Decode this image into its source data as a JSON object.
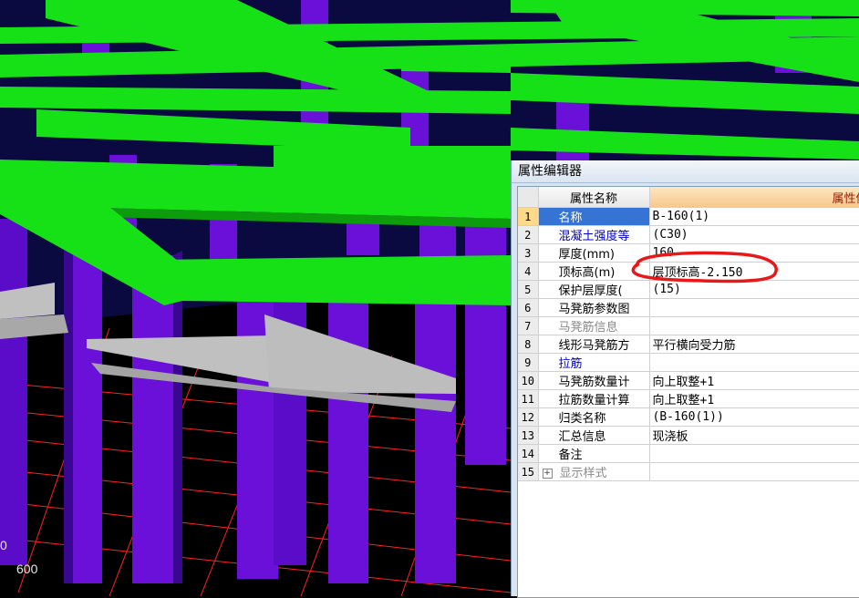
{
  "viewport": {
    "axis_labels": [
      "0",
      "600"
    ]
  },
  "panel": {
    "title": "属性编辑器",
    "header": {
      "name_col": "属性名称",
      "value_col": "属性值"
    },
    "rows": [
      {
        "no": "1",
        "name": "名称",
        "value": "B-160(1)",
        "style": "selected"
      },
      {
        "no": "2",
        "name": "混凝土强度等",
        "value": "(C30)",
        "style": "blue"
      },
      {
        "no": "3",
        "name": "厚度(mm)",
        "value": "160",
        "style": "normal"
      },
      {
        "no": "4",
        "name": "顶标高(m)",
        "value": "层顶标高-2.150",
        "style": "normal"
      },
      {
        "no": "5",
        "name": "保护层厚度(",
        "value": "(15)",
        "style": "normal"
      },
      {
        "no": "6",
        "name": "马凳筋参数图",
        "value": "",
        "style": "normal"
      },
      {
        "no": "7",
        "name": "马凳筋信息",
        "value": "",
        "style": "gray"
      },
      {
        "no": "8",
        "name": "线形马凳筋方",
        "value": "平行横向受力筋",
        "style": "normal"
      },
      {
        "no": "9",
        "name": "拉筋",
        "value": "",
        "style": "blue"
      },
      {
        "no": "10",
        "name": "马凳筋数量计",
        "value": "向上取整+1",
        "style": "normal"
      },
      {
        "no": "11",
        "name": "拉筋数量计算",
        "value": "向上取整+1",
        "style": "normal"
      },
      {
        "no": "12",
        "name": "归类名称",
        "value": "(B-160(1))",
        "style": "normal"
      },
      {
        "no": "13",
        "name": "汇总信息",
        "value": "现浇板",
        "style": "normal"
      },
      {
        "no": "14",
        "name": "备注",
        "value": "",
        "style": "normal"
      },
      {
        "no": "15",
        "name": "显示样式",
        "value": "",
        "style": "gray",
        "expandable": true
      }
    ]
  },
  "colors": {
    "beam": "#16e016",
    "column": "#6a10d8",
    "slab": "#bdbdbd",
    "grid_lines": "#ff2020",
    "annotation": "#e81818"
  }
}
